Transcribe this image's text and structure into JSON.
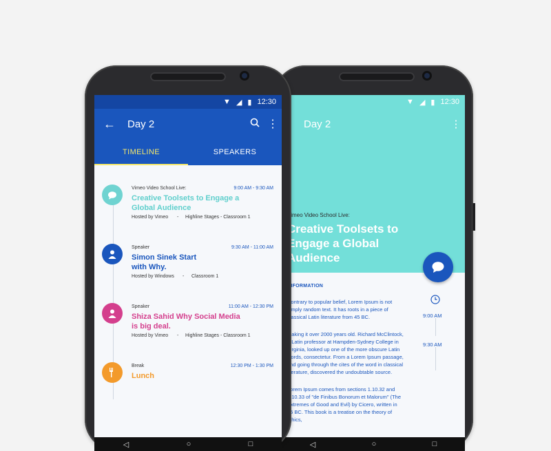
{
  "status": {
    "time": "12:30"
  },
  "left": {
    "title": "Day 2",
    "icons": {
      "back": "arrow-left-icon",
      "search": "search-icon",
      "more": "more-vertical-icon"
    },
    "tabs": [
      {
        "label": "TIMELINE",
        "active": true
      },
      {
        "label": "SPEAKERS",
        "active": false
      }
    ],
    "items": [
      {
        "type": "Vimeo Video School Live:",
        "time": "9:00 AM - 9:30 AM",
        "title": "Creative Toolsets to Engage a Global Audience",
        "host": "Hosted by Vimeo",
        "sep": "-",
        "location": "Highline Stages - Classroom 1",
        "color": "#6fd3d1",
        "icon": "chat-bubble-icon"
      },
      {
        "type": "Speaker",
        "time": "9:30 AM - 11:00 AM",
        "title": "Simon Sinek Start with Why.",
        "host": "Hosted by Windows",
        "sep": "-",
        "location": "Classroom 1",
        "color": "#1a56bd",
        "icon": "person-icon"
      },
      {
        "type": "Speaker",
        "time": "11:00 AM - 12:30 PM",
        "title": "Shiza Sahid Why Social Media is big deal.",
        "host": "Hosted by Vimeo",
        "sep": "-",
        "location": "Highline Stages - Classroom 1",
        "color": "#d43f8d",
        "icon": "person-icon"
      },
      {
        "type": "Break",
        "time": "12:30 PM - 1:30 PM",
        "title": "Lunch",
        "host": "",
        "sep": "",
        "location": "",
        "color": "#f39a2b",
        "icon": "fork-knife-icon"
      }
    ]
  },
  "right": {
    "title": "Day 2",
    "subtitle": "Vimeo Video School Live:",
    "headline": "Creative Toolsets to Engage a Global Audience",
    "section": "INFORMATION",
    "paragraphs": [
      "Contrary to popular belief, Lorem Ipsum is not simply random text. It has roots in a piece of classical Latin literature from 45 BC.",
      "Making it over 2000 years old. Richard McClintock, a Latin professor at Hampden-Sydney College in Virginia, looked up one of the more obscure Latin words, consectetur. From a Lorem Ipsum passage, and going through the cites of the word in classical literature, discovered the undoubtable source.",
      "Lorem Ipsum comes from sections 1.10.32 and 1.10.33 of \"de Finibus Bonorum et Malorum\" (The Extremes of Good and Evil) by Cicero, written in 45 BC. This book is a treatise on the theory of ethics,"
    ],
    "times": [
      "9:00 AM",
      "9:30 AM"
    ],
    "accent": "#73dfd9"
  }
}
